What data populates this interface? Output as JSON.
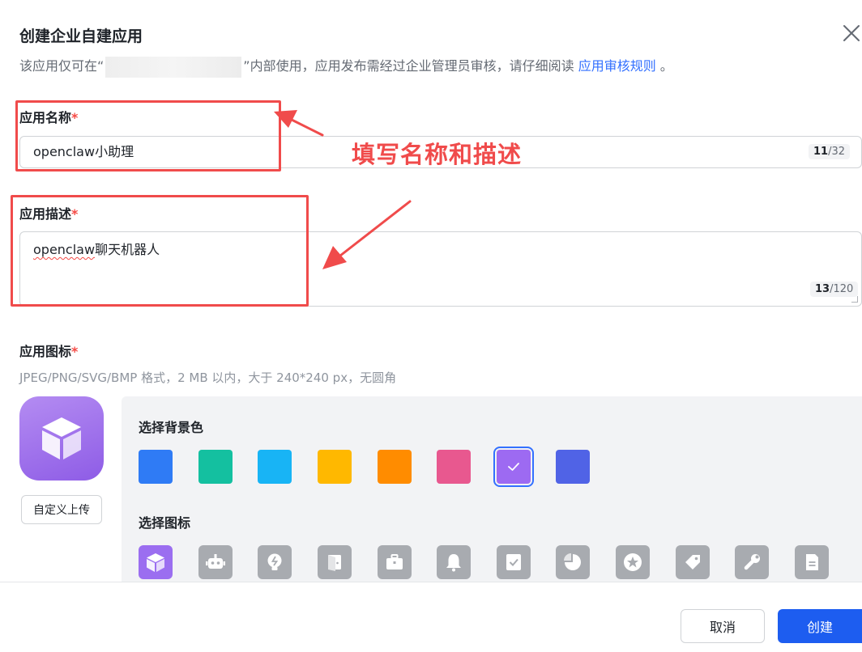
{
  "dialog": {
    "title": "创建企业自建应用",
    "subtitle_prefix": "该应用仅可在“",
    "subtitle_middle": "”内部使用，应用发布需经过企业管理员审核，请仔细阅读",
    "subtitle_link": "应用审核规则",
    "subtitle_suffix": " 。"
  },
  "name_field": {
    "label": "应用名称",
    "required_mark": "*",
    "value_latin": "openclaw",
    "value_cjk": "小助理",
    "counter_current": "11",
    "counter_max": "/32"
  },
  "desc_field": {
    "label": "应用描述",
    "required_mark": "*",
    "value_latin": "openclaw",
    "value_cjk": "聊天机器人",
    "counter_current": "13",
    "counter_max": "/120"
  },
  "icon_field": {
    "label": "应用图标",
    "required_mark": "*",
    "hint": "JPEG/PNG/SVG/BMP 格式，2 MB 以内，大于 240*240 px，无圆角",
    "upload_label": "自定义上传"
  },
  "picker": {
    "bg_title": "选择背景色",
    "icon_title": "选择图标",
    "colors": [
      "#2f7bf5",
      "#14c0a0",
      "#18b4f5",
      "#ffb800",
      "#ff8c00",
      "#e8588f",
      "#9d6af2",
      "#5063e6"
    ],
    "selected_color": "#9d6af2",
    "icons": [
      "cube-icon",
      "robot-icon",
      "lightbulb-icon",
      "door-icon",
      "briefcase-icon",
      "bell-icon",
      "checkbox-icon",
      "pie-icon",
      "star-icon",
      "tag-icon",
      "wrench-icon",
      "document-icon"
    ]
  },
  "annotation": {
    "text": "填写名称和描述",
    "color": "#f04b4b"
  },
  "footer": {
    "cancel_label": "取消",
    "create_label": "创建"
  },
  "colors": {
    "accent": "#1d5df0",
    "link": "#3370ff",
    "required": "#f54a45"
  }
}
